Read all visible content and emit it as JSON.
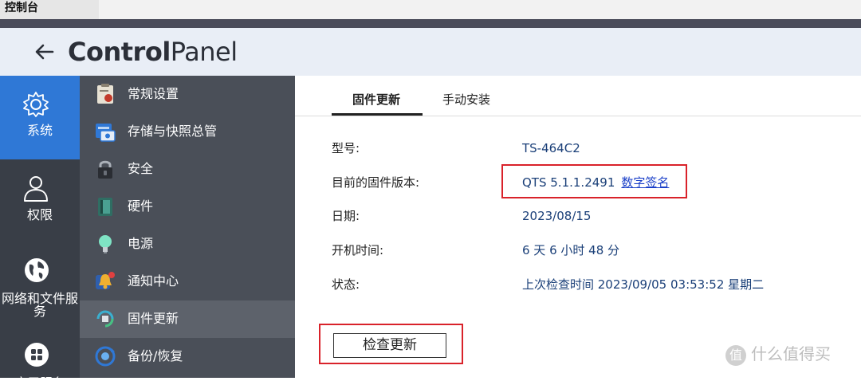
{
  "window": {
    "title": "控制台"
  },
  "header": {
    "brand_bold": "Control",
    "brand_light": "Panel"
  },
  "nav_primary": [
    {
      "label": "系统",
      "icon": "gear-icon",
      "active": true
    },
    {
      "label": "权限",
      "icon": "user-icon",
      "active": false
    },
    {
      "label": "网络和文件服务",
      "icon": "globe-icon",
      "active": false
    },
    {
      "label": "应用服务",
      "icon": "apps-icon",
      "active": false
    }
  ],
  "nav_secondary": [
    {
      "label": "常规设置",
      "icon": "settings-icon"
    },
    {
      "label": "存储与快照总管",
      "icon": "storage-icon"
    },
    {
      "label": "安全",
      "icon": "lock-icon"
    },
    {
      "label": "硬件",
      "icon": "hardware-icon"
    },
    {
      "label": "电源",
      "icon": "power-icon"
    },
    {
      "label": "通知中心",
      "icon": "bell-icon"
    },
    {
      "label": "固件更新",
      "icon": "firmware-icon",
      "active": true
    },
    {
      "label": "备份/恢复",
      "icon": "backup-icon"
    }
  ],
  "tabs": [
    {
      "label": "固件更新",
      "active": true
    },
    {
      "label": "手动安装",
      "active": false
    }
  ],
  "info": {
    "model_label": "型号:",
    "model_value": "TS-464C2",
    "fw_label": "目前的固件版本:",
    "fw_value": "QTS 5.1.1.2491",
    "fw_link": "数字签名",
    "date_label": "日期:",
    "date_value": "2023/08/15",
    "uptime_label": "开机时间:",
    "uptime_value": "6 天 6 小时 48 分",
    "status_label": "状态:",
    "status_value": "上次检查时间 2023/09/05 03:53:52 星期二"
  },
  "check_button": "检查更新",
  "watermark": {
    "text": "什么值得买",
    "glyph": "值"
  },
  "colors": {
    "accent": "#2f78d6",
    "highlight_box": "#d9222a",
    "link": "#1a3fc8"
  }
}
